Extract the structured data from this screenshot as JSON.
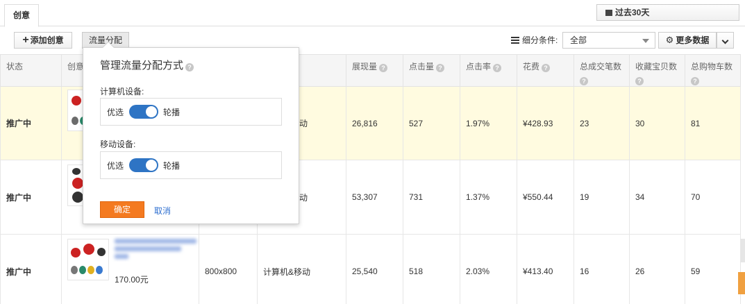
{
  "tabs": {
    "active": "创意"
  },
  "date_range": {
    "label": "过去30天"
  },
  "toolbar": {
    "add_label": "添加创意",
    "flow_label": "流量分配",
    "filter_label": "细分条件:",
    "filter_value": "全部",
    "more_label": "更多数据"
  },
  "columns": {
    "status": "状态",
    "creative": "创意",
    "impressions": "展现量",
    "clicks": "点击量",
    "ctr": "点击率",
    "cost": "花费",
    "total_deals": "总成交笔数",
    "favorites": "收藏宝贝数",
    "cart": "总购物车数"
  },
  "rows": [
    {
      "status": "推广中",
      "device": "动",
      "impressions": "26,816",
      "clicks": "527",
      "ctr": "1.97%",
      "cost": "¥428.93",
      "total_deals": "23",
      "favorites": "30",
      "cart": "81"
    },
    {
      "status": "推广中",
      "device": "动",
      "impressions": "53,307",
      "clicks": "731",
      "ctr": "1.37%",
      "cost": "¥550.44",
      "total_deals": "19",
      "favorites": "34",
      "cart": "70"
    },
    {
      "status": "推广中",
      "size": "800x800",
      "device": "计算机&移动",
      "price": "170.00元",
      "impressions": "25,540",
      "clicks": "518",
      "ctr": "2.03%",
      "cost": "¥413.40",
      "total_deals": "16",
      "favorites": "26",
      "cart": "59"
    }
  ],
  "popover": {
    "title": "管理流量分配方式",
    "pc_label": "计算机设备:",
    "mobile_label": "移动设备:",
    "option_preferred": "优选",
    "option_rotate": "轮播",
    "confirm": "确定",
    "cancel": "取消"
  },
  "colors": {
    "active_status": "#2e9a00",
    "toggle": "#2e74c4",
    "confirm_button": "#f47a20",
    "link": "#2e6fd0",
    "highlight_row": "#fffbe0"
  },
  "icons": [
    "plus-icon",
    "list-icon",
    "chevron-down-icon",
    "gear-icon",
    "help-icon",
    "calendar-icon"
  ]
}
